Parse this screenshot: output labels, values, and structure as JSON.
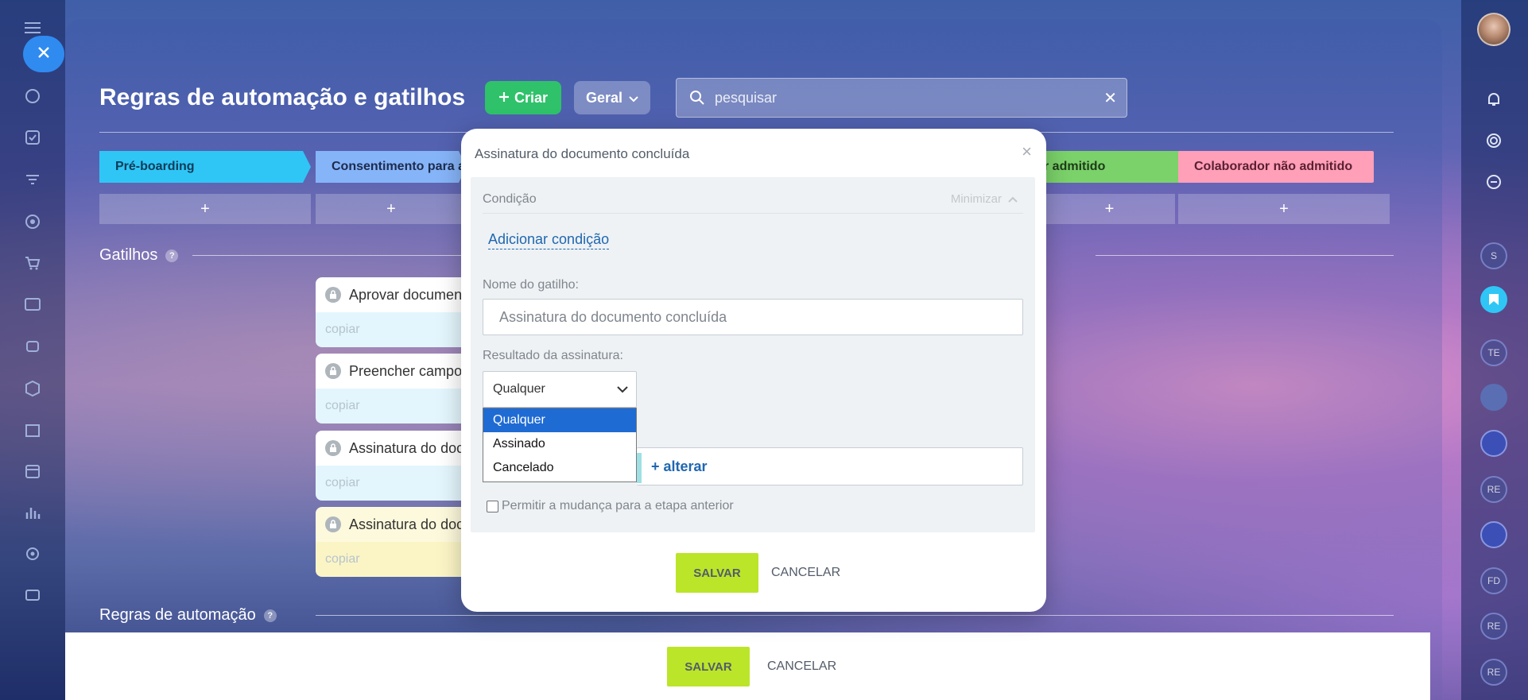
{
  "window": {
    "close_icon": "close-icon"
  },
  "left_rail": {
    "icons": [
      "menu-icon",
      "sites-icon",
      "tasks-icon",
      "filter-icon",
      "target-icon",
      "cart-icon",
      "id-card-icon",
      "robot-icon",
      "box-icon",
      "building-icon",
      "calendar-icon",
      "chart-icon",
      "settings-icon",
      "mail-icon"
    ]
  },
  "right_rail": {
    "chips": [
      "S",
      "TE",
      "RE",
      "FD",
      "RE",
      "RE"
    ]
  },
  "header": {
    "title": "Regras de automação e gatilhos",
    "create_label": "Criar",
    "general_label": "Geral",
    "search_placeholder": "pesquisar"
  },
  "stages": [
    {
      "label": "Pré-boarding",
      "color": "#2fc6f6"
    },
    {
      "label": "Consentimento para a",
      "color": "#86b4f8"
    },
    {
      "label": "r admitido",
      "color": "#7bd16a"
    },
    {
      "label": "Colaborador não admitido",
      "color": "#ff9fb8"
    }
  ],
  "stage_add_label": "+",
  "triggers_section": {
    "title": "Gatilhos",
    "help": "?"
  },
  "trigger_cards": [
    {
      "title": "Aprovar documen",
      "copy": "copiar"
    },
    {
      "title": "Preencher campos",
      "copy": "copiar"
    },
    {
      "title": "Assinatura do doc",
      "copy": "copiar"
    },
    {
      "title": "Assinatura do doc",
      "copy": "copiar"
    }
  ],
  "automation_section": {
    "title": "Regras de automação",
    "help": "?"
  },
  "footer": {
    "save_label": "SALVAR",
    "cancel_label": "CANCELAR"
  },
  "modal": {
    "title": "Assinatura do documento concluída",
    "condition_label": "Condição",
    "minimize_label": "Minimizar",
    "add_condition_label": "Adicionar condição",
    "trigger_name_label": "Nome do gatilho:",
    "trigger_name_value": "Assinatura do documento concluída",
    "result_label": "Resultado da assinatura:",
    "result_selected": "Qualquer",
    "result_options": [
      "Qualquer",
      "Assinado",
      "Cancelado"
    ],
    "change_link": "+ alterar",
    "allow_back_label": "Permitir a mudança para a etapa anterior",
    "save_label": "SALVAR",
    "cancel_label": "CANCELAR"
  },
  "colors": {
    "accent_green": "#bbe529",
    "create_green": "#2fc26a",
    "link_blue": "#2067b0"
  }
}
